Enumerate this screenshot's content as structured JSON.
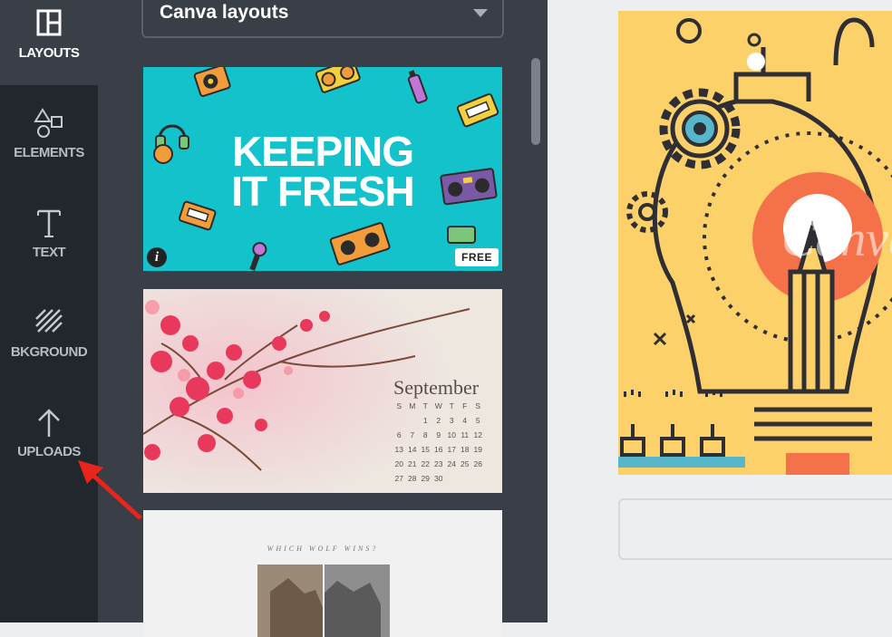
{
  "nav": {
    "items": [
      {
        "label": "LAYOUTS",
        "icon": "layouts-icon",
        "active": true
      },
      {
        "label": "ELEMENTS",
        "icon": "elements-icon",
        "active": false
      },
      {
        "label": "TEXT",
        "icon": "text-icon",
        "active": false
      },
      {
        "label": "BKGROUND",
        "icon": "background-icon",
        "active": false
      },
      {
        "label": "UPLOADS",
        "icon": "upload-icon",
        "active": false
      }
    ]
  },
  "panel": {
    "dropdown": {
      "selected": "Canva layouts"
    },
    "thumbnails": [
      {
        "title_line1": "KEEPING",
        "title_line2": "IT FRESH",
        "badge": "FREE",
        "info": "i"
      },
      {
        "month": "September",
        "weekdays": [
          "S",
          "M",
          "T",
          "W",
          "T",
          "F",
          "S"
        ],
        "weeks": [
          [
            "",
            "",
            "1",
            "2",
            "3",
            "4",
            "5"
          ],
          [
            "6",
            "7",
            "8",
            "9",
            "10",
            "11",
            "12"
          ],
          [
            "13",
            "14",
            "15",
            "16",
            "17",
            "18",
            "19"
          ],
          [
            "20",
            "21",
            "22",
            "23",
            "24",
            "25",
            "26"
          ],
          [
            "27",
            "28",
            "29",
            "30",
            "",
            "",
            ""
          ]
        ]
      },
      {
        "caption": "WHICH WOLF WINS?"
      }
    ]
  },
  "canvas": {
    "watermark": "Canva"
  },
  "colors": {
    "nav_bg": "#22262d",
    "panel_bg": "#3a3e47",
    "thumb1_bg": "#14c2cc",
    "design_bg": "#fdd16a",
    "design_accent": "#f4714a",
    "annotation_arrow": "#e8241b"
  }
}
